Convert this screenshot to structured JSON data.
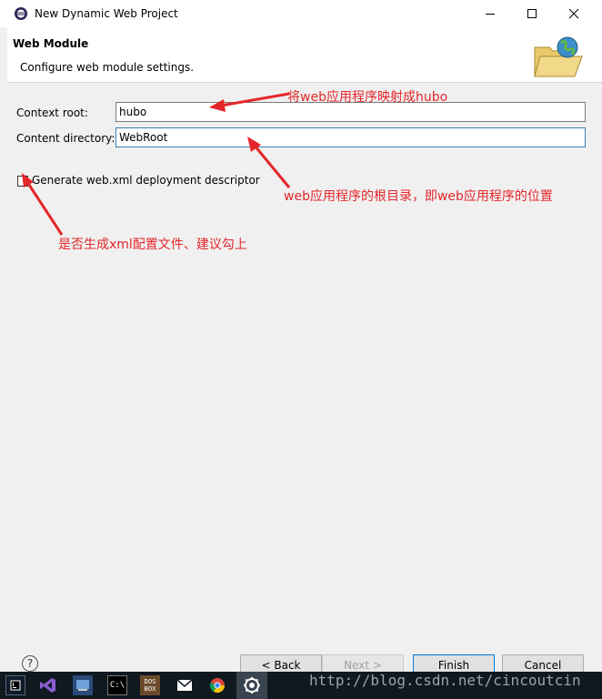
{
  "window": {
    "title": "New Dynamic Web Project",
    "minimize_icon": "minimize-icon",
    "maximize_icon": "maximize-icon",
    "close_icon": "close-icon"
  },
  "header": {
    "title": "Web Module",
    "description": "Configure web module settings.",
    "icon": "globe-folder-icon"
  },
  "form": {
    "context_root_label": "Context root:",
    "context_root_value": "hubo",
    "content_directory_label": "Content directory:",
    "content_directory_value": "WebRoot",
    "generate_webxml_label": "Generate web.xml deployment descriptor",
    "generate_webxml_checked": false
  },
  "annotations": {
    "context_root_note": "将web应用程序映射成hubo",
    "content_directory_note": "web应用程序的根目录，即web应用程序的位置",
    "checkbox_note": "是否生成xml配置文件、建议勾上"
  },
  "buttons": {
    "help_symbol": "?",
    "back": "< Back",
    "next": "Next >",
    "finish": "Finish",
    "cancel": "Cancel"
  },
  "taskbar": {
    "items": [
      "intellij-icon",
      "visual-studio-icon",
      "dev-tool-icon",
      "cmd-icon",
      "dosbox-icon",
      "mail-icon",
      "chrome-icon",
      "eclipse-icon"
    ],
    "cmd_label": "C:\\",
    "dosbox_label": "DOS BOX"
  },
  "watermark": "http://blog.csdn.net/cincoutcin",
  "colors": {
    "annotation": "#e4262a",
    "focus_border": "#3c7fb1",
    "taskbar": "#101820"
  }
}
